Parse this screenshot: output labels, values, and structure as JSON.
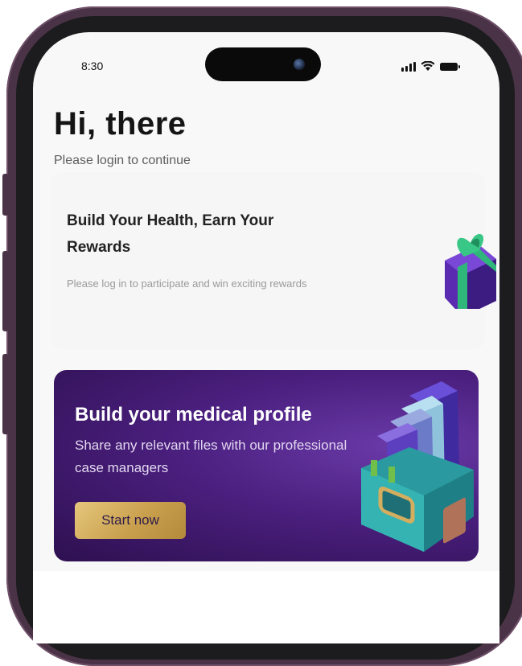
{
  "status_bar": {
    "time": "8:30",
    "icons": [
      "signal-icon",
      "wifi-icon",
      "battery-icon"
    ]
  },
  "header": {
    "greeting": "Hi, there",
    "subtext": "Please login to continue"
  },
  "rewards_card": {
    "title": "Build Your Health, Earn Your Rewards",
    "description": "Please log in to participate and win exciting rewards",
    "icon": "gift-icon"
  },
  "profile_card": {
    "title": "Build your medical profile",
    "description": "Share any relevant files with our professional case managers",
    "button_label": "Start now",
    "icon": "folder-box-icon"
  },
  "colors": {
    "frame": "#4a3346",
    "profile_card_bg": "#4a1f7e",
    "button_gold": "#d4ae5e",
    "screen_bg": "#f8f8f8"
  }
}
